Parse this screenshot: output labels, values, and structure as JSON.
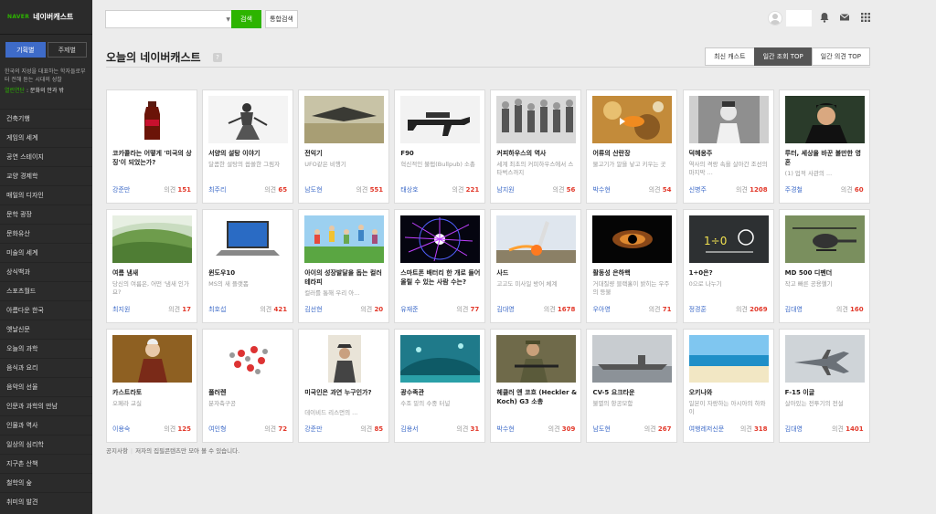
{
  "brand": {
    "naver": "NAVER",
    "name": "네이버캐스트"
  },
  "sidebar": {
    "modes": [
      {
        "label": "기획별",
        "active": true
      },
      {
        "label": "주제별",
        "active": false
      }
    ],
    "intro": "한국의 지성을 대표하는 학자들로부터 전해 듣는 시대의 성찰",
    "selected_prefix": "열린연단",
    "selected_text": " : 문화의 안과 밖",
    "categories": [
      "건축기행",
      "게임의 세계",
      "공연 스테이지",
      "교양 경제학",
      "매일의 디자인",
      "문학 광장",
      "문화유산",
      "미술의 세계",
      "상식백과",
      "스포츠월드",
      "아름다운 한국",
      "옛날신문",
      "오늘의 과학",
      "음식과 요리",
      "음악의 선율",
      "인문과 과학의 만남",
      "인물과 역사",
      "일상의 심리학",
      "지구촌 산책",
      "철학의 숲",
      "취미의 발견"
    ]
  },
  "search": {
    "placeholder": "",
    "button": "검색",
    "all_button": "통합검색"
  },
  "header": {
    "title": "오늘의 네이버캐스트",
    "help": "?",
    "tabs": [
      {
        "label": "최신 캐스트",
        "active": false
      },
      {
        "label": "일간 조회 TOP",
        "active": true
      },
      {
        "label": "일간 의견 TOP",
        "active": false
      }
    ]
  },
  "cards": [
    {
      "title": "코카콜라는 어떻게 '미국의 상징'이 되었는가?",
      "desc": "",
      "author": "강준만",
      "comments_label": "의견",
      "comments": "151",
      "thumb": "coke"
    },
    {
      "title": "서양의 설탕 이야기",
      "desc": "달콤한 설탕의 씁쓸한 그림자",
      "author": "최주리",
      "comments_label": "의견",
      "comments": "65",
      "thumb": "sugar"
    },
    {
      "title": "전익기",
      "desc": "UFO같은 비행기",
      "author": "남도현",
      "comments_label": "의견",
      "comments": "551",
      "thumb": "wing"
    },
    {
      "title": "F90",
      "desc": "혁신적인 불펍(Bullpub) 소총",
      "author": "태상호",
      "comments_label": "의견",
      "comments": "221",
      "thumb": "rifle"
    },
    {
      "title": "커피하우스의 역사",
      "desc": "세계 최초의 커피하우스에서 스타벅스까지",
      "author": "남지원",
      "comments_label": "의견",
      "comments": "56",
      "thumb": "coffee"
    },
    {
      "title": "어류의 산란장",
      "desc": "물고기가 알을 낳고 키우는 곳",
      "author": "박수현",
      "comments_label": "의견",
      "comments": "54",
      "thumb": "fish"
    },
    {
      "title": "덕혜옹주",
      "desc": "역사의 격랑 속을 살아간 조선의 마지막 ...",
      "author": "신병주",
      "comments_label": "의견",
      "comments": "1208",
      "thumb": "princess"
    },
    {
      "title": "루터, 세상을 바꾼 불만한 영혼",
      "desc": "(1) 업적 사관의 ...",
      "author": "주경철",
      "comments_label": "의견",
      "comments": "60",
      "thumb": "luther"
    },
    {
      "title": "여름 냄새",
      "desc": "당신의 여름은, 어떤 '냄새 인가요?",
      "author": "최지원",
      "comments_label": "의견",
      "comments": "17",
      "thumb": "field"
    },
    {
      "title": "윈도우10",
      "desc": "MS의 새 플랫폼",
      "author": "최호섭",
      "comments_label": "의견",
      "comments": "421",
      "thumb": "laptop"
    },
    {
      "title": "아이의 성장발달을 돕는 컬러 테라피",
      "desc": "컬러를 통해 우리 아...",
      "author": "김선현",
      "comments_label": "의견",
      "comments": "20",
      "thumb": "kids"
    },
    {
      "title": "스마트폰 배터리 한 개로 들어올릴 수 있는 사람 수는?",
      "desc": "",
      "author": "유재준",
      "comments_label": "의견",
      "comments": "77",
      "thumb": "plasma"
    },
    {
      "title": "사드",
      "desc": "고고도 미사일 방어 체계",
      "author": "김대영",
      "comments_label": "의견",
      "comments": "1678",
      "thumb": "missile"
    },
    {
      "title": "활동성 은하핵",
      "desc": "거대질량 블랙홀이 밝히는 우주의 등불",
      "author": "우아영",
      "comments_label": "의견",
      "comments": "71",
      "thumb": "galaxy"
    },
    {
      "title": "1÷0은?",
      "desc": "0으로 나누기",
      "author": "정경훈",
      "comments_label": "의견",
      "comments": "2069",
      "thumb": "math"
    },
    {
      "title": "MD 500 디펜더",
      "desc": "작고 빠른 공용헬기",
      "author": "김대영",
      "comments_label": "의견",
      "comments": "160",
      "thumb": "heli"
    },
    {
      "title": "카스트라토",
      "desc": "오페라 교실",
      "author": "이용숙",
      "comments_label": "의견",
      "comments": "125",
      "thumb": "portrait"
    },
    {
      "title": "풀러렌",
      "desc": "분자축구공",
      "author": "여인형",
      "comments_label": "의견",
      "comments": "72",
      "thumb": "fullerene"
    },
    {
      "title": "미국인은 과연 누구인가?",
      "desc": "데이비드 리스먼의 ...",
      "author": "강준만",
      "comments_label": "의견",
      "comments": "85",
      "thumb": "book"
    },
    {
      "title": "광수족관",
      "desc": "수조 밑의 수중 터널",
      "author": "김용서",
      "comments_label": "의견",
      "comments": "31",
      "thumb": "aquarium"
    },
    {
      "title": "헤클러 앤 코흐 (Heckler & Koch) G3 소총",
      "desc": "",
      "author": "박수현",
      "comments_label": "의견",
      "comments": "309",
      "thumb": "soldier"
    },
    {
      "title": "CV-5 요크타운",
      "desc": "불멸의 항공모함",
      "author": "남도현",
      "comments_label": "의견",
      "comments": "267",
      "thumb": "carrier"
    },
    {
      "title": "오키나와",
      "desc": "일본이 자랑하는 아시아의 하와이",
      "author": "여행레저신문",
      "comments_label": "의견",
      "comments": "318",
      "thumb": "beach"
    },
    {
      "title": "F-15 이글",
      "desc": "살아있는 전투기의 전설",
      "author": "김대영",
      "comments_label": "의견",
      "comments": "1401",
      "thumb": "jet"
    }
  ],
  "notice": {
    "label": "공지사항",
    "text": "저자의 집필콘텐츠만 모아 볼 수 있습니다."
  }
}
